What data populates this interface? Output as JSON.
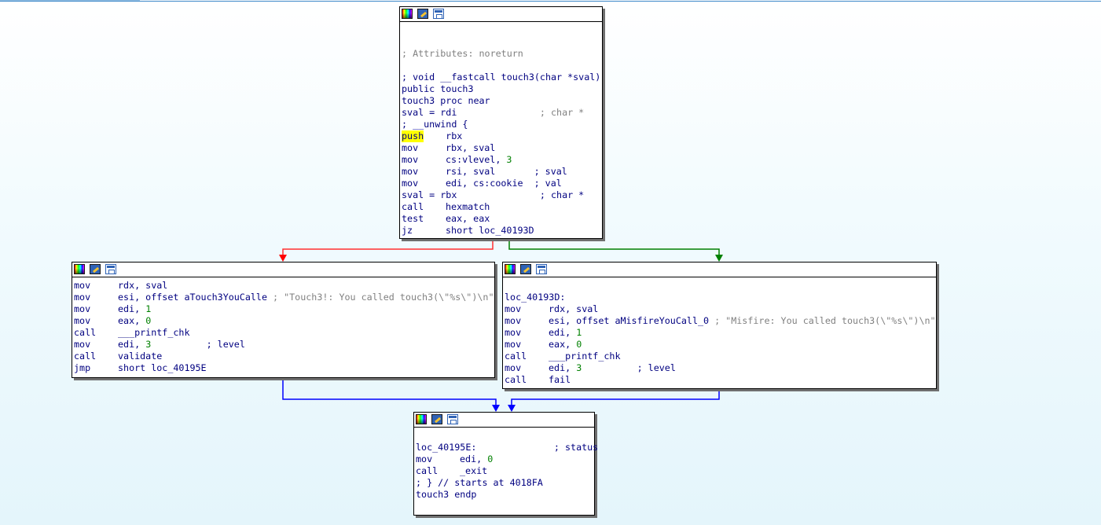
{
  "node_top": {
    "lines": [
      {
        "text": ""
      },
      {
        "text": ""
      },
      {
        "cmt": "; Attributes: noreturn"
      },
      {
        "text": ""
      },
      {
        "cmtb": "; void __fastcall touch3(char *sval)"
      },
      {
        "text": "public touch3"
      },
      {
        "text": "touch3 proc near"
      },
      {
        "text": "sval = rdi               ",
        "cmt": "; char *"
      },
      {
        "cmtb": "; __unwind {"
      },
      {
        "mn": "push",
        "highlight": true,
        "ops": "rbx"
      },
      {
        "mn": "mov",
        "ops": "rbx, sval"
      },
      {
        "mn": "mov",
        "ops": "cs:vlevel, ",
        "num": "3"
      },
      {
        "mn": "mov",
        "ops": "rsi, sval       ",
        "cmtb": "; sval"
      },
      {
        "mn": "mov",
        "ops": "edi, cs:cookie  ",
        "cmtb": "; val"
      },
      {
        "text": "sval = rbx               ",
        "cmtb": "; char *"
      },
      {
        "mn": "call",
        "ops": "hexmatch"
      },
      {
        "mn": "test",
        "ops": "eax, eax"
      },
      {
        "mn": "jz",
        "ops": "short loc_40193D"
      }
    ]
  },
  "node_left": {
    "lines": [
      {
        "mn": "mov",
        "ops": "rdx, sval"
      },
      {
        "mn": "mov",
        "ops": "esi, offset aTouch3YouCalle ",
        "cmt": "; \"Touch3!: You called touch3(\\\"%s\\\")\\n\""
      },
      {
        "mn": "mov",
        "ops": "edi, ",
        "num": "1"
      },
      {
        "mn": "mov",
        "ops": "eax, ",
        "num": "0"
      },
      {
        "mn": "call",
        "ops": "___printf_chk"
      },
      {
        "mn": "mov",
        "ops": "edi, ",
        "num": "3",
        "tail": "          ",
        "cmtb": "; level"
      },
      {
        "mn": "call",
        "ops": "validate"
      },
      {
        "mn": "jmp",
        "ops": "short loc_40195E"
      }
    ]
  },
  "node_right": {
    "lines": [
      {
        "text": ""
      },
      {
        "text": "loc_40193D:"
      },
      {
        "mn": "mov",
        "ops": "rdx, sval"
      },
      {
        "mn": "mov",
        "ops": "esi, offset aMisfireYouCall_0 ",
        "cmt": "; \"Misfire: You called touch3(\\\"%s\\\")\\n\""
      },
      {
        "mn": "mov",
        "ops": "edi, ",
        "num": "1"
      },
      {
        "mn": "mov",
        "ops": "eax, ",
        "num": "0"
      },
      {
        "mn": "call",
        "ops": "___printf_chk"
      },
      {
        "mn": "mov",
        "ops": "edi, ",
        "num": "3",
        "tail": "          ",
        "cmtb": "; level"
      },
      {
        "mn": "call",
        "ops": "fail"
      }
    ]
  },
  "node_bottom": {
    "lines": [
      {
        "text": ""
      },
      {
        "text": "loc_40195E:              ",
        "cmtb": "; status"
      },
      {
        "mn": "mov",
        "ops": "edi, ",
        "num": "0"
      },
      {
        "mn": "call",
        "ops": "_exit"
      },
      {
        "cmtb": "; } // starts at 4018FA"
      },
      {
        "text": "touch3 endp"
      }
    ]
  },
  "colors": {
    "edge_false": "#ff0000",
    "edge_true": "#008000",
    "edge_uncond": "#0000ff",
    "highlight": "#ffff00"
  }
}
